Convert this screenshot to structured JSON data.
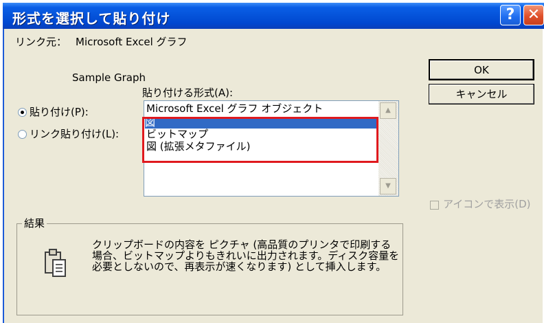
{
  "dialog": {
    "title": "形式を選択して貼り付け",
    "help_glyph": "?",
    "close_glyph": "✕"
  },
  "source": {
    "label": "リンク元：",
    "value": "Microsoft Excel グラフ",
    "item": "Sample Graph"
  },
  "format": {
    "label": "貼り付ける形式(A):",
    "items": [
      {
        "label": "Microsoft Excel グラフ オブジェクト",
        "selected": false
      },
      {
        "label": "図",
        "selected": true
      },
      {
        "label": "ビットマップ",
        "selected": false
      },
      {
        "label": "図 (拡張メタファイル)",
        "selected": false
      }
    ]
  },
  "options": {
    "paste_label": "貼り付け(P):",
    "paste_link_label": "リンク貼り付け(L):",
    "selected": "paste"
  },
  "buttons": {
    "ok": "OK",
    "cancel": "キャンセル"
  },
  "display_as_icon": {
    "label": "アイコンで表示(D)",
    "checked": false,
    "enabled": false
  },
  "result": {
    "group_label": "結果",
    "text": "クリップボードの内容を ピクチャ (高品質のプリンタで印刷する場合、ビットマップよりもきれいに出力されます。ディスク容量を必要としないので、再表示が速くなります) として挿入します。"
  },
  "annotation": {
    "highlight_color": "#e0191e"
  }
}
